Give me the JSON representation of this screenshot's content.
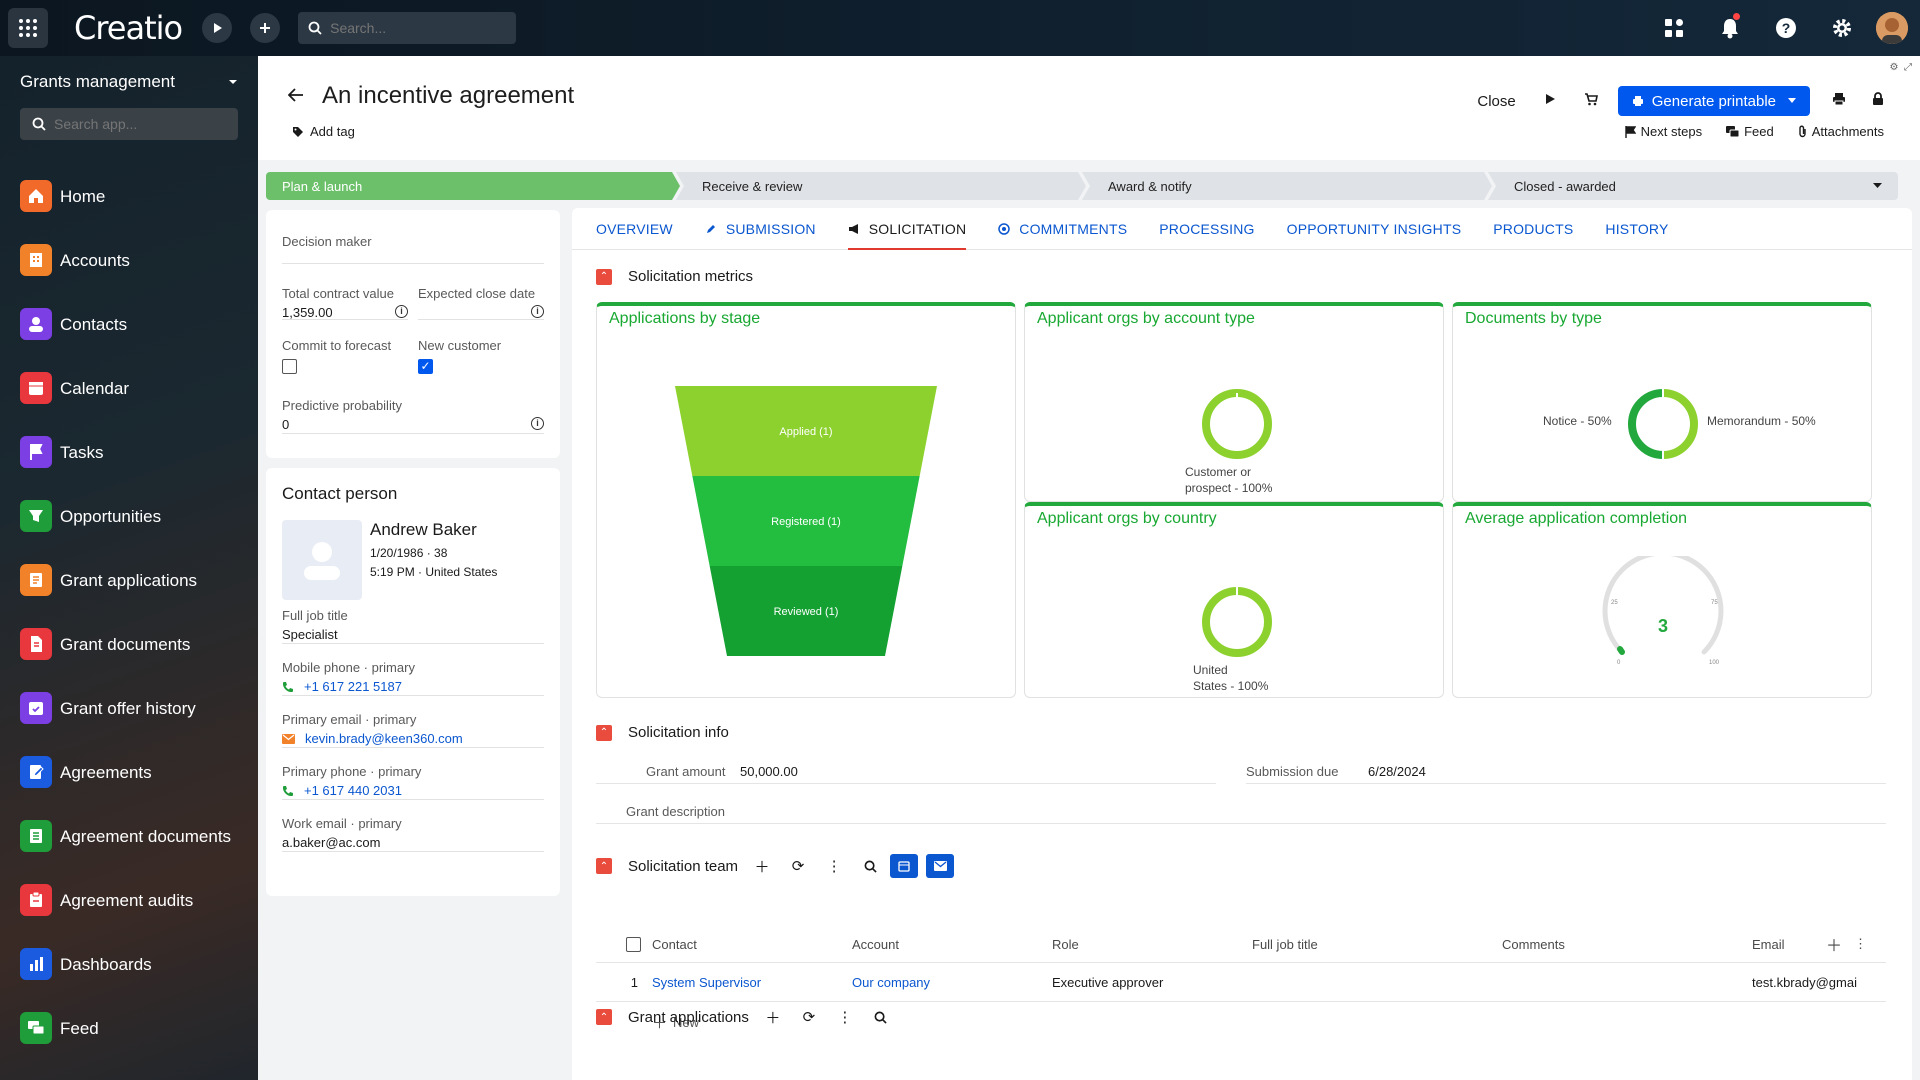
{
  "topbar": {
    "logo": "Creatio",
    "search_placeholder": "Search..."
  },
  "sidebar": {
    "workspace": "Grants management",
    "search_placeholder": "Search app...",
    "items": [
      {
        "label": "Home",
        "color": "#f26a2a",
        "icon": "home-icon"
      },
      {
        "label": "Accounts",
        "color": "#f2822a",
        "icon": "building-icon"
      },
      {
        "label": "Contacts",
        "color": "#7b3fe4",
        "icon": "person-icon"
      },
      {
        "label": "Calendar",
        "color": "#e8373d",
        "icon": "calendar-icon"
      },
      {
        "label": "Tasks",
        "color": "#7b3fe4",
        "icon": "flag-icon"
      },
      {
        "label": "Opportunities",
        "color": "#1f9d3a",
        "icon": "funnel-icon"
      },
      {
        "label": "Grant applications",
        "color": "#f2822a",
        "icon": "form-icon"
      },
      {
        "label": "Grant documents",
        "color": "#e8373d",
        "icon": "document-icon"
      },
      {
        "label": "Grant offer history",
        "color": "#7b3fe4",
        "icon": "calendar-check-icon"
      },
      {
        "label": "Agreements",
        "color": "#1b5be0",
        "icon": "edit-doc-icon"
      },
      {
        "label": "Agreement documents",
        "color": "#1f9d3a",
        "icon": "doc-list-icon"
      },
      {
        "label": "Agreement audits",
        "color": "#e8373d",
        "icon": "audit-icon"
      },
      {
        "label": "Dashboards",
        "color": "#1b5be0",
        "icon": "bar-chart-icon"
      },
      {
        "label": "Feed",
        "color": "#1f9d3a",
        "icon": "chat-icon"
      }
    ]
  },
  "header": {
    "title": "An incentive agreement",
    "add_tag": "Add tag",
    "close": "Close",
    "generate": "Generate printable",
    "links": [
      "Next steps",
      "Feed",
      "Attachments"
    ]
  },
  "stages": [
    "Plan & launch",
    "Receive & review",
    "Award & notify",
    "Closed - awarded"
  ],
  "left": {
    "decision_maker_label": "Decision maker",
    "total_value_label": "Total contract value",
    "total_value": "1,359.00",
    "close_date_label": "Expected close date",
    "commit_label": "Commit to forecast",
    "new_customer_label": "New customer",
    "probability_label": "Predictive probability",
    "probability": "0"
  },
  "contact": {
    "heading": "Contact person",
    "name": "Andrew Baker",
    "dob": "1/20/1986 · 38",
    "time_loc": "5:19 PM · United States",
    "job_label": "Full job title",
    "job": "Specialist",
    "mobile_label": "Mobile phone · primary",
    "mobile": "+1 617 221 5187",
    "email_label": "Primary email · primary",
    "email": "kevin.brady@keen360.com",
    "phone_label": "Primary phone · primary",
    "phone": "+1 617 440 2031",
    "work_email_label": "Work email · primary",
    "work_email": "a.baker@ac.com"
  },
  "tabs": [
    "OVERVIEW",
    "SUBMISSION",
    "SOLICITATION",
    "COMMITMENTS",
    "PROCESSING",
    "OPPORTUNITY INSIGHTS",
    "PRODUCTS",
    "HISTORY"
  ],
  "sections": {
    "metrics": "Solicitation metrics",
    "info": "Solicitation info",
    "team": "Solicitation team",
    "grants": "Grant applications"
  },
  "widgets": {
    "stage": {
      "title": "Applications by stage",
      "levels": [
        "Applied (1)",
        "Registered (1)",
        "Reviewed (1)"
      ]
    },
    "account_type": {
      "title": "Applicant orgs by account type",
      "label_1": "Customer or",
      "label_2": "prospect - 100%"
    },
    "doc_type": {
      "title": "Documents by type",
      "left": "Notice - 50%",
      "right": "Memorandum - 50%"
    },
    "country": {
      "title": "Applicant orgs by country",
      "label_1": "United",
      "label_2": "States - 100%"
    },
    "completion": {
      "title": "Average application completion",
      "value": "3",
      "ticks": [
        "0",
        "25",
        "75",
        "100"
      ]
    }
  },
  "chart_data": [
    {
      "type": "funnel",
      "title": "Applications by stage",
      "categories": [
        "Applied",
        "Registered",
        "Reviewed"
      ],
      "values": [
        1,
        1,
        1
      ]
    },
    {
      "type": "pie",
      "title": "Applicant orgs by account type",
      "categories": [
        "Customer or prospect"
      ],
      "values": [
        100
      ]
    },
    {
      "type": "pie",
      "title": "Documents by type",
      "categories": [
        "Notice",
        "Memorandum"
      ],
      "values": [
        50,
        50
      ]
    },
    {
      "type": "pie",
      "title": "Applicant orgs by country",
      "categories": [
        "United States"
      ],
      "values": [
        100
      ]
    },
    {
      "type": "gauge",
      "title": "Average application completion",
      "value": 3,
      "range": [
        0,
        100
      ]
    }
  ],
  "info": {
    "grant_amount_label": "Grant amount",
    "grant_amount": "50,000.00",
    "submission_due_label": "Submission due",
    "submission_due": "6/28/2024",
    "description_label": "Grant description"
  },
  "team_table": {
    "headers": [
      "Contact",
      "Account",
      "Role",
      "Full job title",
      "Comments",
      "Email"
    ],
    "row": {
      "index": "1",
      "contact": "System Supervisor",
      "account": "Our company",
      "role": "Executive approver",
      "email": "test.kbrady@gmai"
    },
    "new_label": "New"
  }
}
